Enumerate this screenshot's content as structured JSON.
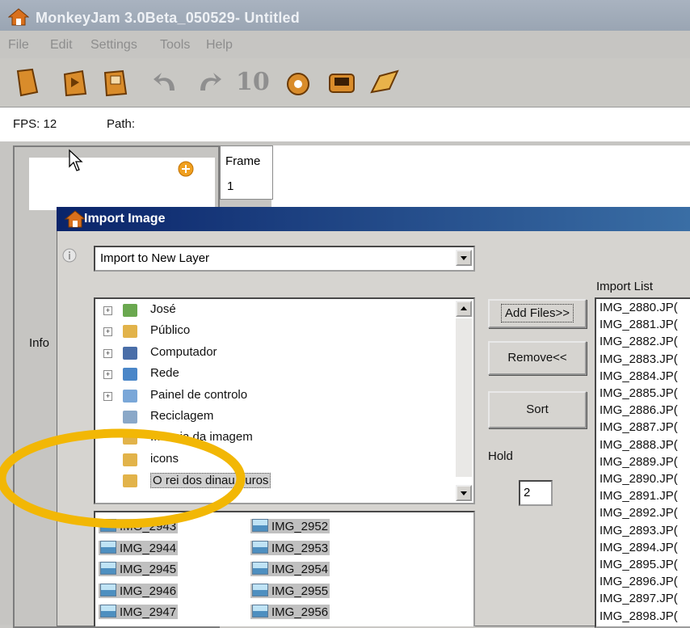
{
  "window": {
    "title": "MonkeyJam 3.0Beta_050529- Untitled"
  },
  "menu": [
    "File",
    "Edit",
    "Settings",
    "Tools",
    "Help"
  ],
  "toolbar": {
    "icons": [
      "new-file-icon",
      "open-file-icon",
      "save-file-icon",
      "undo-icon",
      "redo-icon",
      "ten-icon",
      "capture-icon",
      "camera-icon",
      "export-icon"
    ],
    "ten_label": "10"
  },
  "status": {
    "fps_label": "FPS: 12",
    "path_label": "Path:"
  },
  "left_panel": {
    "info_label": "Info"
  },
  "frame_column": {
    "header": "Frame",
    "first_row": "1"
  },
  "dialog": {
    "title": "Import Image",
    "import_mode": "Import to New Layer",
    "tree": [
      {
        "label": "José",
        "expandable": true
      },
      {
        "label": "Público",
        "expandable": true
      },
      {
        "label": "Computador",
        "expandable": true
      },
      {
        "label": "Rede",
        "expandable": true
      },
      {
        "label": "Painel de controlo",
        "expandable": true
      },
      {
        "label": "Reciclagem",
        "expandable": false
      },
      {
        "label": "...encia da imagem",
        "expandable": false
      },
      {
        "label": "icons",
        "expandable": false
      },
      {
        "label": "O rei dos dinau...uros",
        "expandable": false
      }
    ],
    "buttons": {
      "add": "Add Files>>",
      "remove": "Remove<<",
      "sort": "Sort"
    },
    "hold": {
      "label": "Hold",
      "value": "2"
    },
    "import_list_label": "Import List",
    "import_list": [
      "IMG_2880.JP(",
      "IMG_2881.JP(",
      "IMG_2882.JP(",
      "IMG_2883.JP(",
      "IMG_2884.JP(",
      "IMG_2885.JP(",
      "IMG_2886.JP(",
      "IMG_2887.JP(",
      "IMG_2888.JP(",
      "IMG_2889.JP(",
      "IMG_2890.JP(",
      "IMG_2891.JP(",
      "IMG_2892.JP(",
      "IMG_2893.JP(",
      "IMG_2894.JP(",
      "IMG_2895.JP(",
      "IMG_2896.JP(",
      "IMG_2897.JP(",
      "IMG_2898.JP("
    ],
    "files_col1": [
      "IMG_2943",
      "IMG_2944",
      "IMG_2945",
      "IMG_2946",
      "IMG_2947"
    ],
    "files_col2": [
      "IMG_2952",
      "IMG_2953",
      "IMG_2954",
      "IMG_2955",
      "IMG_2956"
    ]
  },
  "colors": {
    "highlight_circle": "#f2b705",
    "dialog_title": "#0a246a"
  }
}
